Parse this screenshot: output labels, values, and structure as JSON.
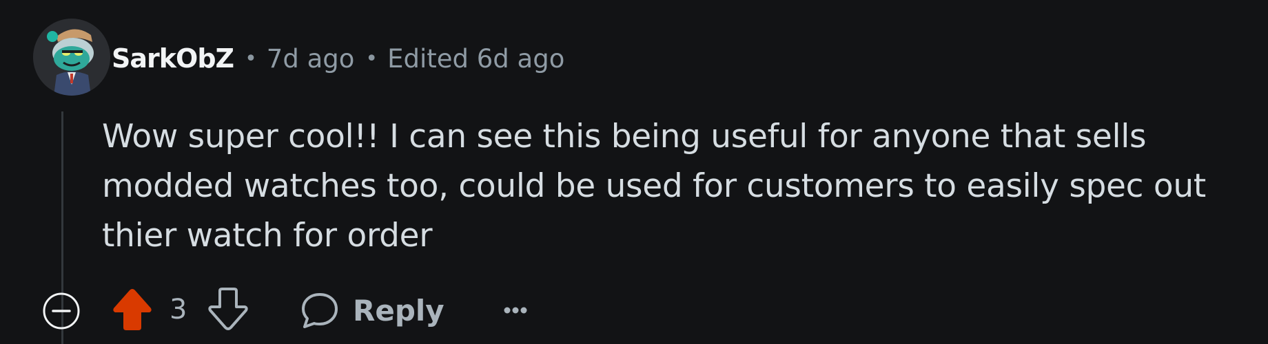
{
  "comment": {
    "author": "SarkObZ",
    "separator": "•",
    "posted": "7d ago",
    "edited": "Edited 6d ago",
    "body": "Wow super cool!! I can see this being useful for anyone that sells modded watches too, could be used for customers to easily spec out thier watch for order",
    "score": "3",
    "reply_label": "Reply"
  },
  "icons": {
    "avatar": "avatar-snoo-icon",
    "collapse": "collapse-minus-circle-icon",
    "upvote": "upvote-arrow-icon",
    "downvote": "downvote-arrow-icon",
    "reply": "speech-bubble-icon",
    "more": "ellipsis-icon"
  },
  "colors": {
    "background": "#121315",
    "upvote_active": "#d93a00",
    "text_primary": "#f2f4f5",
    "text_secondary": "#8f9ba5"
  }
}
